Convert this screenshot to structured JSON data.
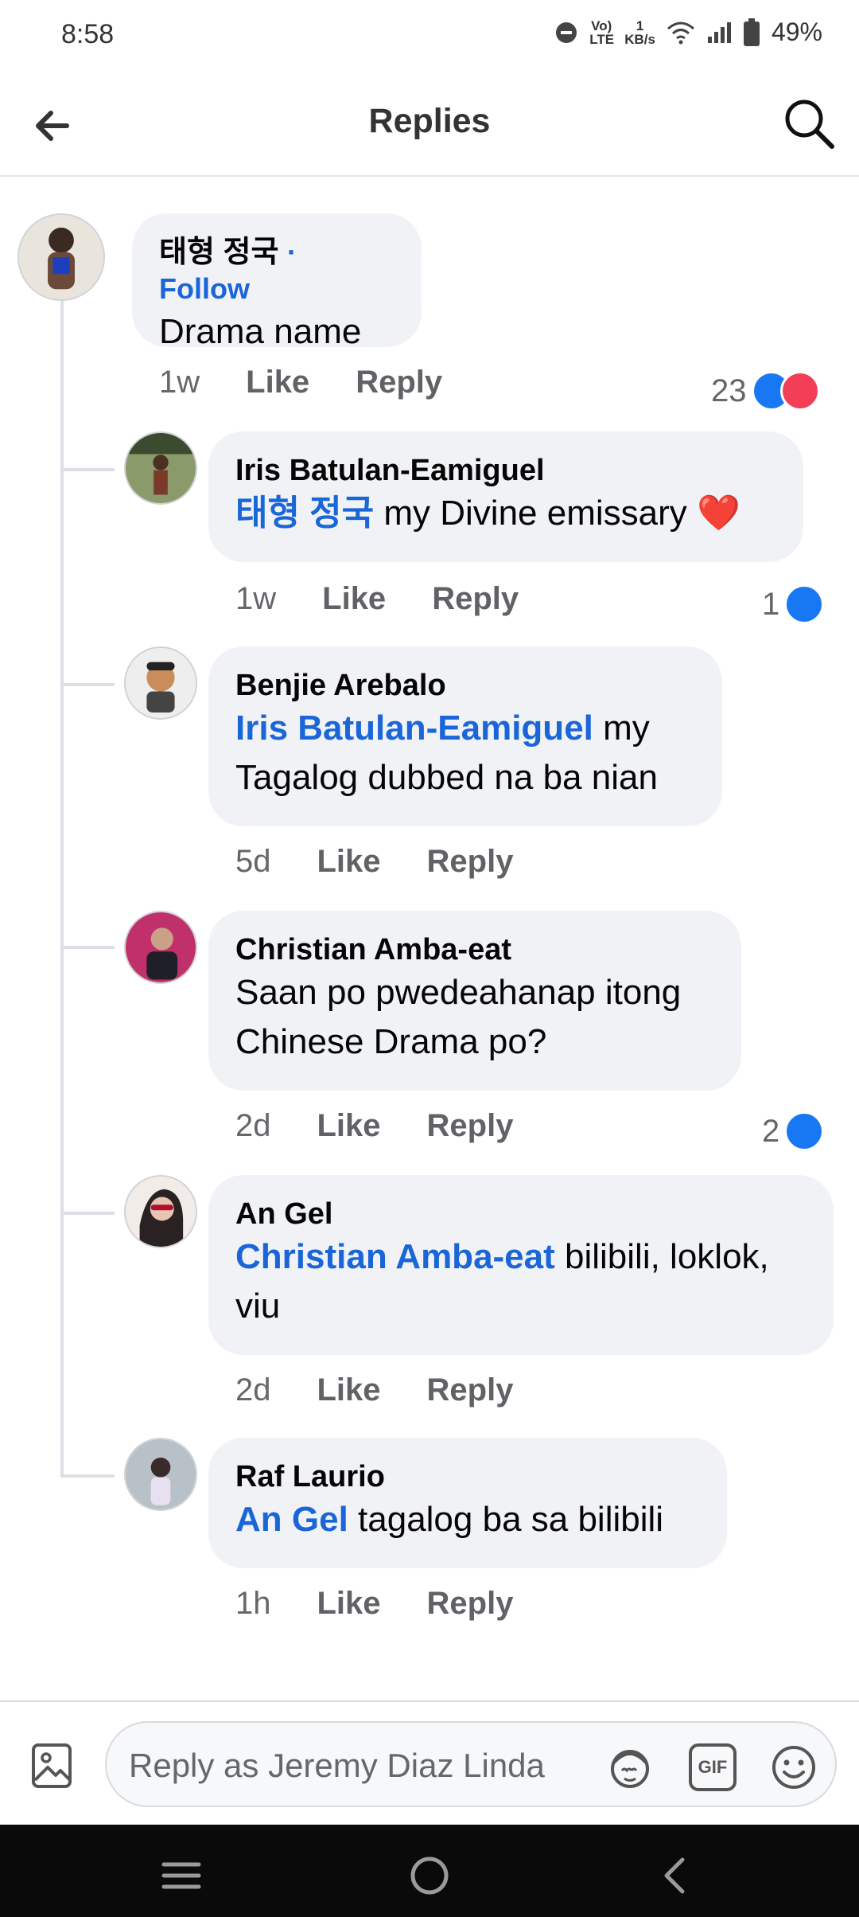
{
  "status": {
    "time": "8:58",
    "volte": "Vo) LTE",
    "speed_value": "1",
    "speed_unit": "KB/s",
    "battery": "49%"
  },
  "header": {
    "title": "Replies",
    "back_icon": "arrow-left-icon",
    "search_icon": "search-icon"
  },
  "parent_comment": {
    "author": "태형 정국",
    "follow": "· Follow",
    "text": "Drama name",
    "time": "1w",
    "like": "Like",
    "reply": "Reply",
    "reaction_count": "23"
  },
  "replies": [
    {
      "author": "Iris Batulan-Eamiguel",
      "mention": "태형 정국",
      "text": " my Divine emissary ",
      "emoji": "❤️",
      "time": "1w",
      "like": "Like",
      "reply": "Reply",
      "reaction_count": "1"
    },
    {
      "author": "Benjie Arebalo",
      "mention": "Iris Batulan-Eamiguel",
      "text": " my Tagalog dubbed na ba nian",
      "time": "5d",
      "like": "Like",
      "reply": "Reply"
    },
    {
      "author": "Christian Amba-eat",
      "mention": "",
      "text": "Saan po pwedeahanap itong Chinese Drama po?",
      "time": "2d",
      "like": "Like",
      "reply": "Reply",
      "reaction_count": "2"
    },
    {
      "author": "An Gel",
      "mention": "Christian Amba-eat",
      "text": " bilibili, loklok, viu",
      "time": "2d",
      "like": "Like",
      "reply": "Reply"
    },
    {
      "author": "Raf Laurio",
      "mention": "An Gel",
      "text": " tagalog ba sa bilibili",
      "time": "1h",
      "like": "Like",
      "reply": "Reply"
    }
  ],
  "composer": {
    "placeholder": "Reply as Jeremy Diaz Linda",
    "gif": "GIF"
  },
  "colors": {
    "accent": "#1a66d8",
    "like": "#1877f2",
    "love": "#f33e58",
    "bubble": "#f0f2f5"
  }
}
